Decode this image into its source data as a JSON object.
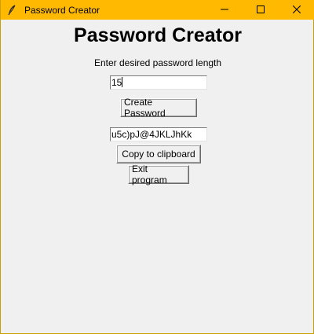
{
  "window": {
    "title": "Password Creator",
    "icon": "feather-icon",
    "titlebar_color": "#ffb900",
    "controls": {
      "minimize": "minimize-icon",
      "maximize": "maximize-icon",
      "close": "close-icon"
    }
  },
  "main": {
    "heading": "Password Creator",
    "prompt": "Enter desired password length",
    "length_input": {
      "value": "15"
    },
    "create_button_label": "Create Password",
    "password_output": {
      "value": "u5c)pJ@4JKLJhKk"
    },
    "copy_button_label": "Copy to clipboard",
    "exit_button_label": "Exit program"
  }
}
